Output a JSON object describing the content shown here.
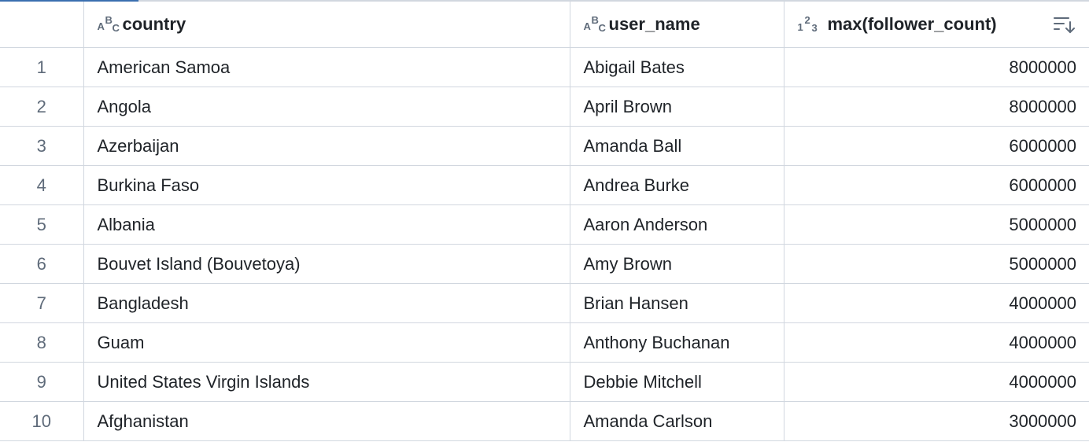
{
  "columns": {
    "index": "",
    "country": {
      "label": "country",
      "type_icon": "string-type-icon"
    },
    "user_name": {
      "label": "user_name",
      "type_icon": "string-type-icon"
    },
    "max_follower_count": {
      "label": "max(follower_count)",
      "type_icon": "number-type-icon",
      "sort_icon": "sort-descending-icon"
    }
  },
  "rows": [
    {
      "index": "1",
      "country": "American Samoa",
      "user_name": "Abigail Bates",
      "max_follower_count": "8000000"
    },
    {
      "index": "2",
      "country": "Angola",
      "user_name": "April Brown",
      "max_follower_count": "8000000"
    },
    {
      "index": "3",
      "country": "Azerbaijan",
      "user_name": "Amanda Ball",
      "max_follower_count": "6000000"
    },
    {
      "index": "4",
      "country": "Burkina Faso",
      "user_name": "Andrea Burke",
      "max_follower_count": "6000000"
    },
    {
      "index": "5",
      "country": "Albania",
      "user_name": "Aaron Anderson",
      "max_follower_count": "5000000"
    },
    {
      "index": "6",
      "country": "Bouvet Island (Bouvetoya)",
      "user_name": "Amy Brown",
      "max_follower_count": "5000000"
    },
    {
      "index": "7",
      "country": "Bangladesh",
      "user_name": "Brian Hansen",
      "max_follower_count": "4000000"
    },
    {
      "index": "8",
      "country": "Guam",
      "user_name": "Anthony Buchanan",
      "max_follower_count": "4000000"
    },
    {
      "index": "9",
      "country": "United States Virgin Islands",
      "user_name": "Debbie Mitchell",
      "max_follower_count": "4000000"
    },
    {
      "index": "10",
      "country": "Afghanistan",
      "user_name": "Amanda Carlson",
      "max_follower_count": "3000000"
    }
  ]
}
